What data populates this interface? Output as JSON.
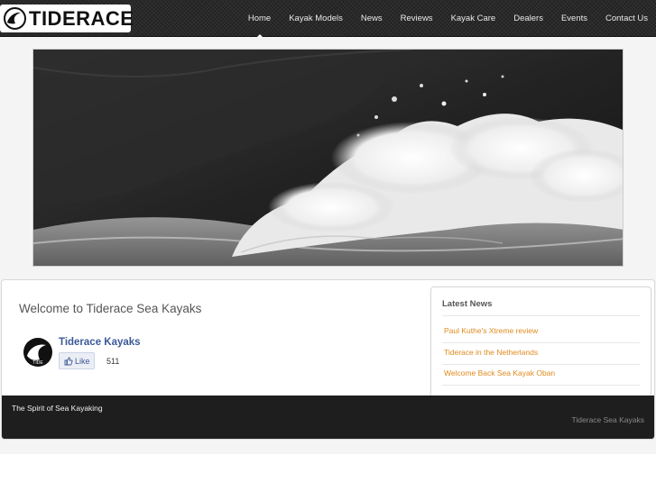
{
  "header": {
    "logo_text": "TIDERACE",
    "nav": [
      {
        "label": "Home",
        "active": true
      },
      {
        "label": "Kayak Models"
      },
      {
        "label": "News"
      },
      {
        "label": "Reviews"
      },
      {
        "label": "Kayak Care"
      },
      {
        "label": "Dealers"
      },
      {
        "label": "Events"
      },
      {
        "label": "Contact Us"
      }
    ]
  },
  "main": {
    "welcome_title": "Welcome to Tiderace Sea Kayaks",
    "facebook": {
      "page_name": "Tiderace Kayaks",
      "like_label": "Like",
      "like_count": "511"
    }
  },
  "latest_news": {
    "title": "Latest News",
    "items": [
      "Paul Kuthe's Xtreme review",
      "Tiderace in the Netherlands",
      "Welcome Back Sea Kayak Oban"
    ]
  },
  "footer": {
    "tagline": "The Spirit of Sea Kayaking",
    "brand": "Tiderace Sea Kayaks"
  },
  "colors": {
    "header_bg": "#222222",
    "link_orange": "#e08a1e",
    "facebook_blue": "#3b5998",
    "footer_bg": "#1e1e1e"
  }
}
